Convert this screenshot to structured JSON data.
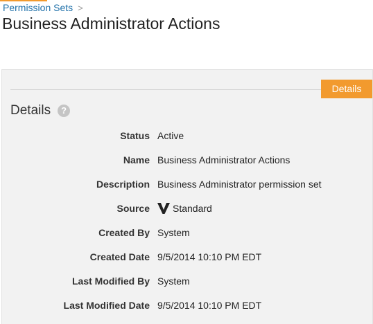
{
  "breadcrumb": {
    "parent_label": "Permission Sets",
    "separator": ">"
  },
  "page_title": "Business Administrator Actions",
  "tabs": [
    {
      "label": "Details",
      "active": true
    }
  ],
  "section": {
    "heading": "Details",
    "help_icon": "question-circle-icon",
    "help_glyph": "?"
  },
  "fields": [
    {
      "label": "Status",
      "value": "Active"
    },
    {
      "label": "Name",
      "value": "Business Administrator Actions"
    },
    {
      "label": "Description",
      "value": "Business Administrator permission set"
    },
    {
      "label": "Source",
      "value": "Standard",
      "icon": "veeva-v-logo-icon"
    },
    {
      "label": "Created By",
      "value": "System"
    },
    {
      "label": "Created Date",
      "value": "9/5/2014 10:10 PM EDT"
    },
    {
      "label": "Last Modified By",
      "value": "System"
    },
    {
      "label": "Last Modified Date",
      "value": "9/5/2014 10:10 PM EDT"
    }
  ],
  "colors": {
    "accent": "#f29a2e",
    "link": "#1f70a9",
    "panel_bg": "#f2f2f2"
  }
}
